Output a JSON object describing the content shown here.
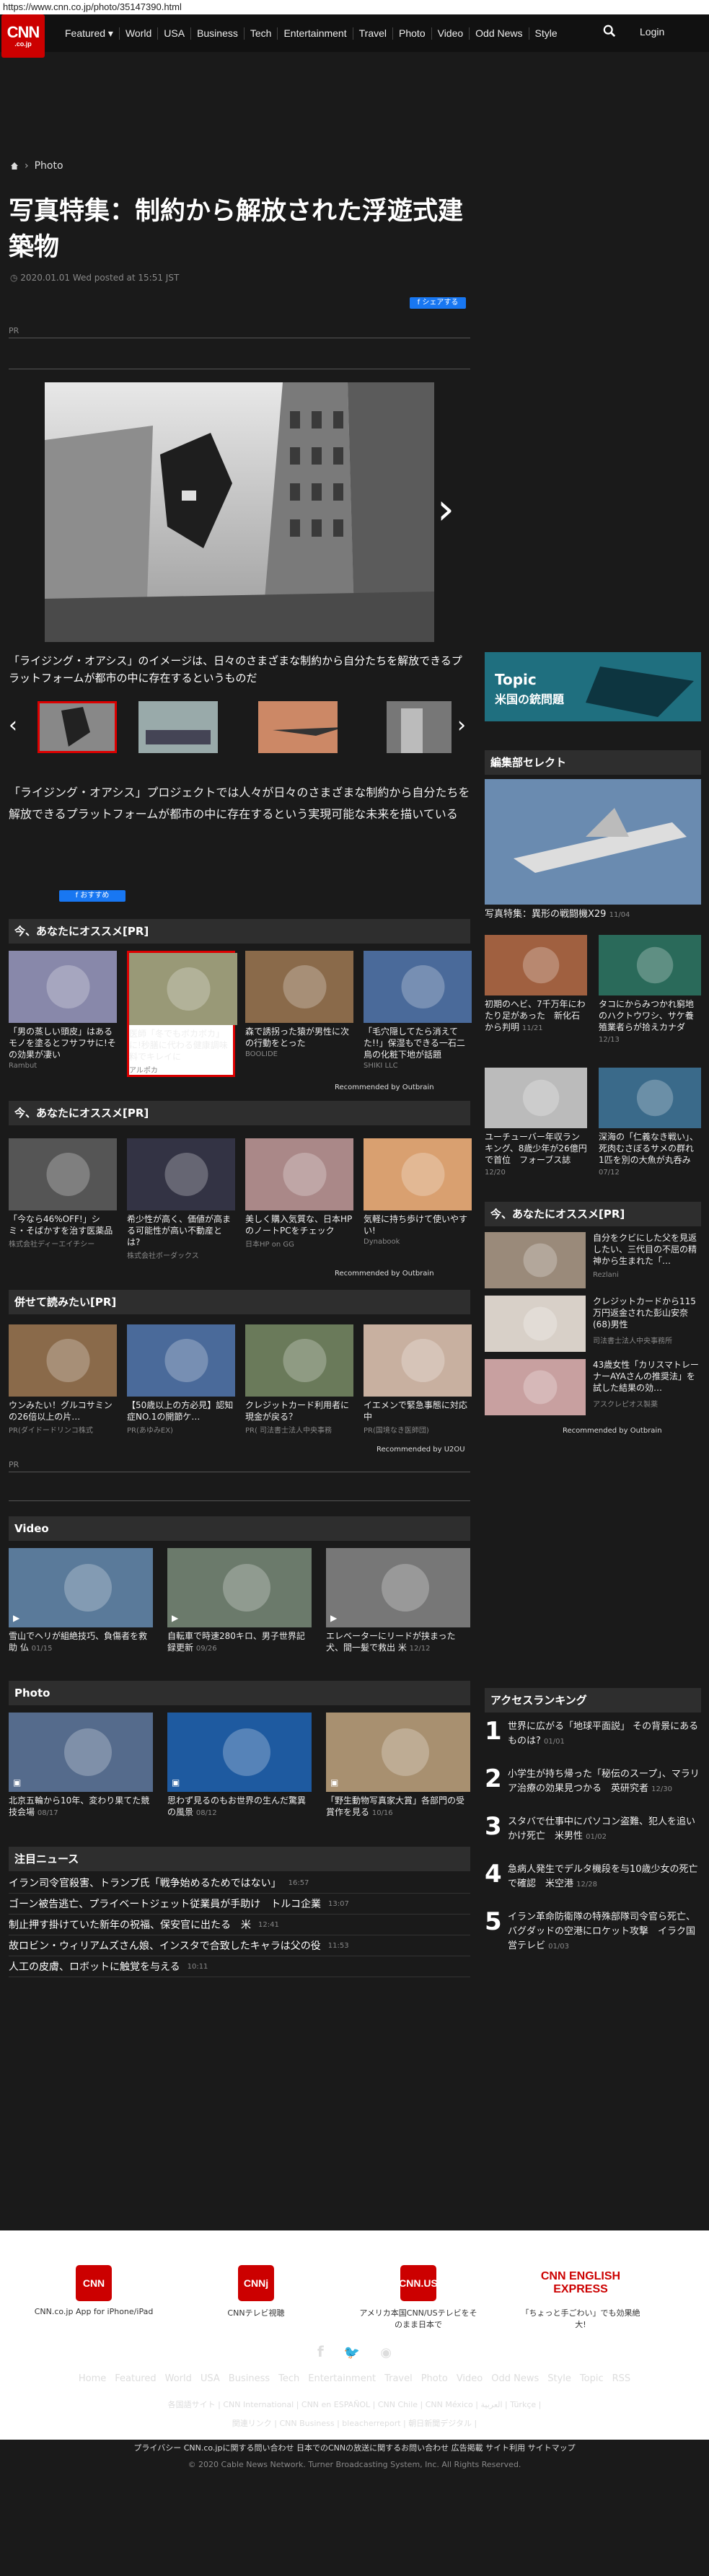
{
  "url": "https://www.cnn.co.jp/photo/35147390.html",
  "logo": {
    "top": "CNN",
    "bottom": ".co.jp"
  },
  "nav": [
    "Featured ▾",
    "World",
    "USA",
    "Business",
    "Tech",
    "Entertainment",
    "Travel",
    "Photo",
    "Video",
    "Odd News",
    "Style"
  ],
  "login": "Login",
  "breadcrumb": {
    "home_icon": "home-icon",
    "section": "Photo"
  },
  "title": "写真特集：制約から解放された浮遊式建築物",
  "date": "2020.01.01 Wed posted at 15:51 JST",
  "share": "シェアする",
  "pr": "PR",
  "caption": "「ライジング・オアシス」のイメージは、日々のさまざまな制約から自分たちを解放できるプラットフォームが都市の中に存在するというものだ",
  "description": "「ライジング・オアシス」プロジェクトでは人々が日々のさまざまな制約から自分たちを解放できるプラットフォームが都市の中に存在するという実現可能な未来を描いている",
  "recommend_btn": "おすすめ",
  "sections": {
    "rec1": "今、あなたにオススメ[PR]",
    "rec2": "今、あなたにオススメ[PR]",
    "read": "併せて読みたい[PR]",
    "video": "Video",
    "photo": "Photo",
    "attention": "注目ニュース",
    "editor": "編集部セレクト",
    "rec_right": "今、あなたにオススメ[PR]",
    "ranking": "アクセスランキング"
  },
  "rec1": [
    {
      "title": "「男の蒸しい頭皮」はあるモノを塗るとフサフサに!その効果が凄い",
      "source": "Rambut"
    },
    {
      "title": "医師「冬でもボカボカ」に!秒膳に代わる健康調味料でキレイに",
      "source": "アルポカ"
    },
    {
      "title": "森で誘拐った猿が男性に次の行動をとった",
      "source": "BOOLIDE"
    },
    {
      "title": "「毛穴隠してたら消えてた!!」保湿もできる一石二鳥の化粧下地が話題",
      "source": "SHIKI LLC"
    }
  ],
  "outbrain": "Recommended by Outbrain",
  "rec2": [
    {
      "title": "「今なら46%OFF!」シミ・そばかすを治す医薬品",
      "source": "株式会社ディーエイチシー"
    },
    {
      "title": "希少性が高く、価値が高まる可能性が高い不動産とは?",
      "source": "株式会社ボーダックス"
    },
    {
      "title": "美しく購入気質な、日本HPのノートPCをチェック",
      "source": "日本HP on GG"
    },
    {
      "title": "気軽に持ち歩けて使いやすい!",
      "source": "Dynabook"
    }
  ],
  "read": [
    {
      "title": "ウンみたい！グルコサミンの26倍以上の片…",
      "source": "PR(ダイドードリンコ株式"
    },
    {
      "title": "【50歳以上の方必見】認知症NO.1の開節ケ…",
      "source": "PR(あゆみEX)"
    },
    {
      "title": "クレジットカード利用者に現金が戻る？",
      "source": "PR( 司法書士法人中央事務"
    },
    {
      "title": "イエメンで緊急事態に対応中",
      "source": "PR(国境なき医師団)"
    }
  ],
  "read_footer": "Recommended by U2OU",
  "videos": [
    {
      "title": "雪山でヘリが組絶技巧、負傷者を救助 仏",
      "time": "01/15"
    },
    {
      "title": "自転車で時速280キロ、男子世界記録更新",
      "time": "09/26"
    },
    {
      "title": "エレベーターにリードが挟まった犬、間一髪で救出 米",
      "time": "12/12"
    }
  ],
  "photos": [
    {
      "title": "北京五輪から10年、変わり果てた競技会場",
      "time": "08/17"
    },
    {
      "title": "思わず見るのもお世界の生んだ驚異の風景",
      "time": "08/12"
    },
    {
      "title": "「野生動物写真家大賞」各部門の受賞作を見る",
      "time": "10/16"
    }
  ],
  "attention": [
    {
      "title": "イラン司令官殺害、トランプ氏「戦争始めるためではない」",
      "time": "16:57"
    },
    {
      "title": "ゴーン被告逃亡、プライベートジェット従業員が手助け　トルコ企業",
      "time": "13:07"
    },
    {
      "title": "制止押す掛けていた新年の祝福、保安官に出たる　米",
      "time": "12:41"
    },
    {
      "title": "故ロビン・ウィリアムズさん娘、インスタで合致したキャラは父の役",
      "time": "11:53"
    },
    {
      "title": "人工の皮膚、ロボットに触覚を与える",
      "time": "10:11"
    }
  ],
  "topic": {
    "label": "Topic",
    "text": "米国の銃問題"
  },
  "editor_main": {
    "title": "写真特集：異形の戦闘機X29",
    "time": "11/04"
  },
  "editor_items": [
    {
      "title": "初期のヘビ、7千万年にわたり足があった　新化石から判明",
      "time": "11/21"
    },
    {
      "title": "タコにからみつかれ窮地のハクトウワシ、サケ養殖業者らが拾えカナダ",
      "time": "12/13"
    },
    {
      "title": "ユーチューバー年収ランキング、8歳少年が26億円で首位　フォーブス誌",
      "time": "12/20"
    },
    {
      "title": "深海の「仁義なき戦い」、死肉むさぼるサメの群れ　1匹を別の大魚が丸呑み",
      "time": "07/12"
    }
  ],
  "rec_right": [
    {
      "title": "自分をクビにした父を見返したい、三代目の不屈の精神から生まれた「…",
      "source": "Rezlani"
    },
    {
      "title": "クレジットカードから115万円返金された彭山安奈(68)男性",
      "source": "司法書士法人中央事務所"
    },
    {
      "title": "43歳女性「カリスマトレーナーAYAさんの推奨法」を試した結果の効…",
      "source": "アスクレピオス製薬"
    }
  ],
  "ranking": [
    {
      "n": "1",
      "title": "世界に広がる「地球平面説」 その背景にあるものは?",
      "time": "01/01"
    },
    {
      "n": "2",
      "title": "小学生が持ち帰った「秘伝のスープ」、マラリア治療の効果見つかる　英研究者",
      "time": "12/30"
    },
    {
      "n": "3",
      "title": "スタバで仕事中にパソコン盗難、犯人を追いかけ死亡　米男性",
      "time": "01/02"
    },
    {
      "n": "4",
      "title": "急病人発生でデルタ機段を与10歳少女の死亡で確認　米空港",
      "time": "12/28"
    },
    {
      "n": "5",
      "title": "イラン革命防衛隊の特殊部隊司令官ら死亡、バグダッドの空港にロケット攻撃　イラク国営テレビ",
      "time": "01/03"
    }
  ],
  "apps": [
    {
      "icon": "CNN",
      "label": "CNN.co.jp App for iPhone/iPad"
    },
    {
      "icon": "CNNj",
      "label": "CNNテレビ視聴"
    },
    {
      "icon": "CNN.US",
      "label": "アメリカ本国CNN/USテレビをそのまま日本で"
    },
    {
      "icon": "CNN ENGLISH EXPRESS",
      "label": "「ちょっと手ごわい」でも効果絶大!"
    }
  ],
  "footer_nav": [
    "Home",
    "Featured",
    "World",
    "USA",
    "Business",
    "Tech",
    "Entertainment",
    "Travel",
    "Photo",
    "Video",
    "Odd News",
    "Style",
    "Topic",
    "RSS"
  ],
  "footer_links1": "各国語サイト | CNN International | CNN en ESPAÑOL | CNN Chile | CNN México | العربية | Türkçe |",
  "footer_links2": "関連リンク | CNN Business | bleacherreport | 朝日新聞デジタル |",
  "footer_links3": "プライバシー  CNN.co.jpに関する問い合わせ  日本でのCNNの放送に関するお問い合わせ  広告掲載  サイト利用  サイトマップ",
  "copyright": "© 2020 Cable News Network. Turner Broadcasting System, Inc. All Rights Reserved."
}
